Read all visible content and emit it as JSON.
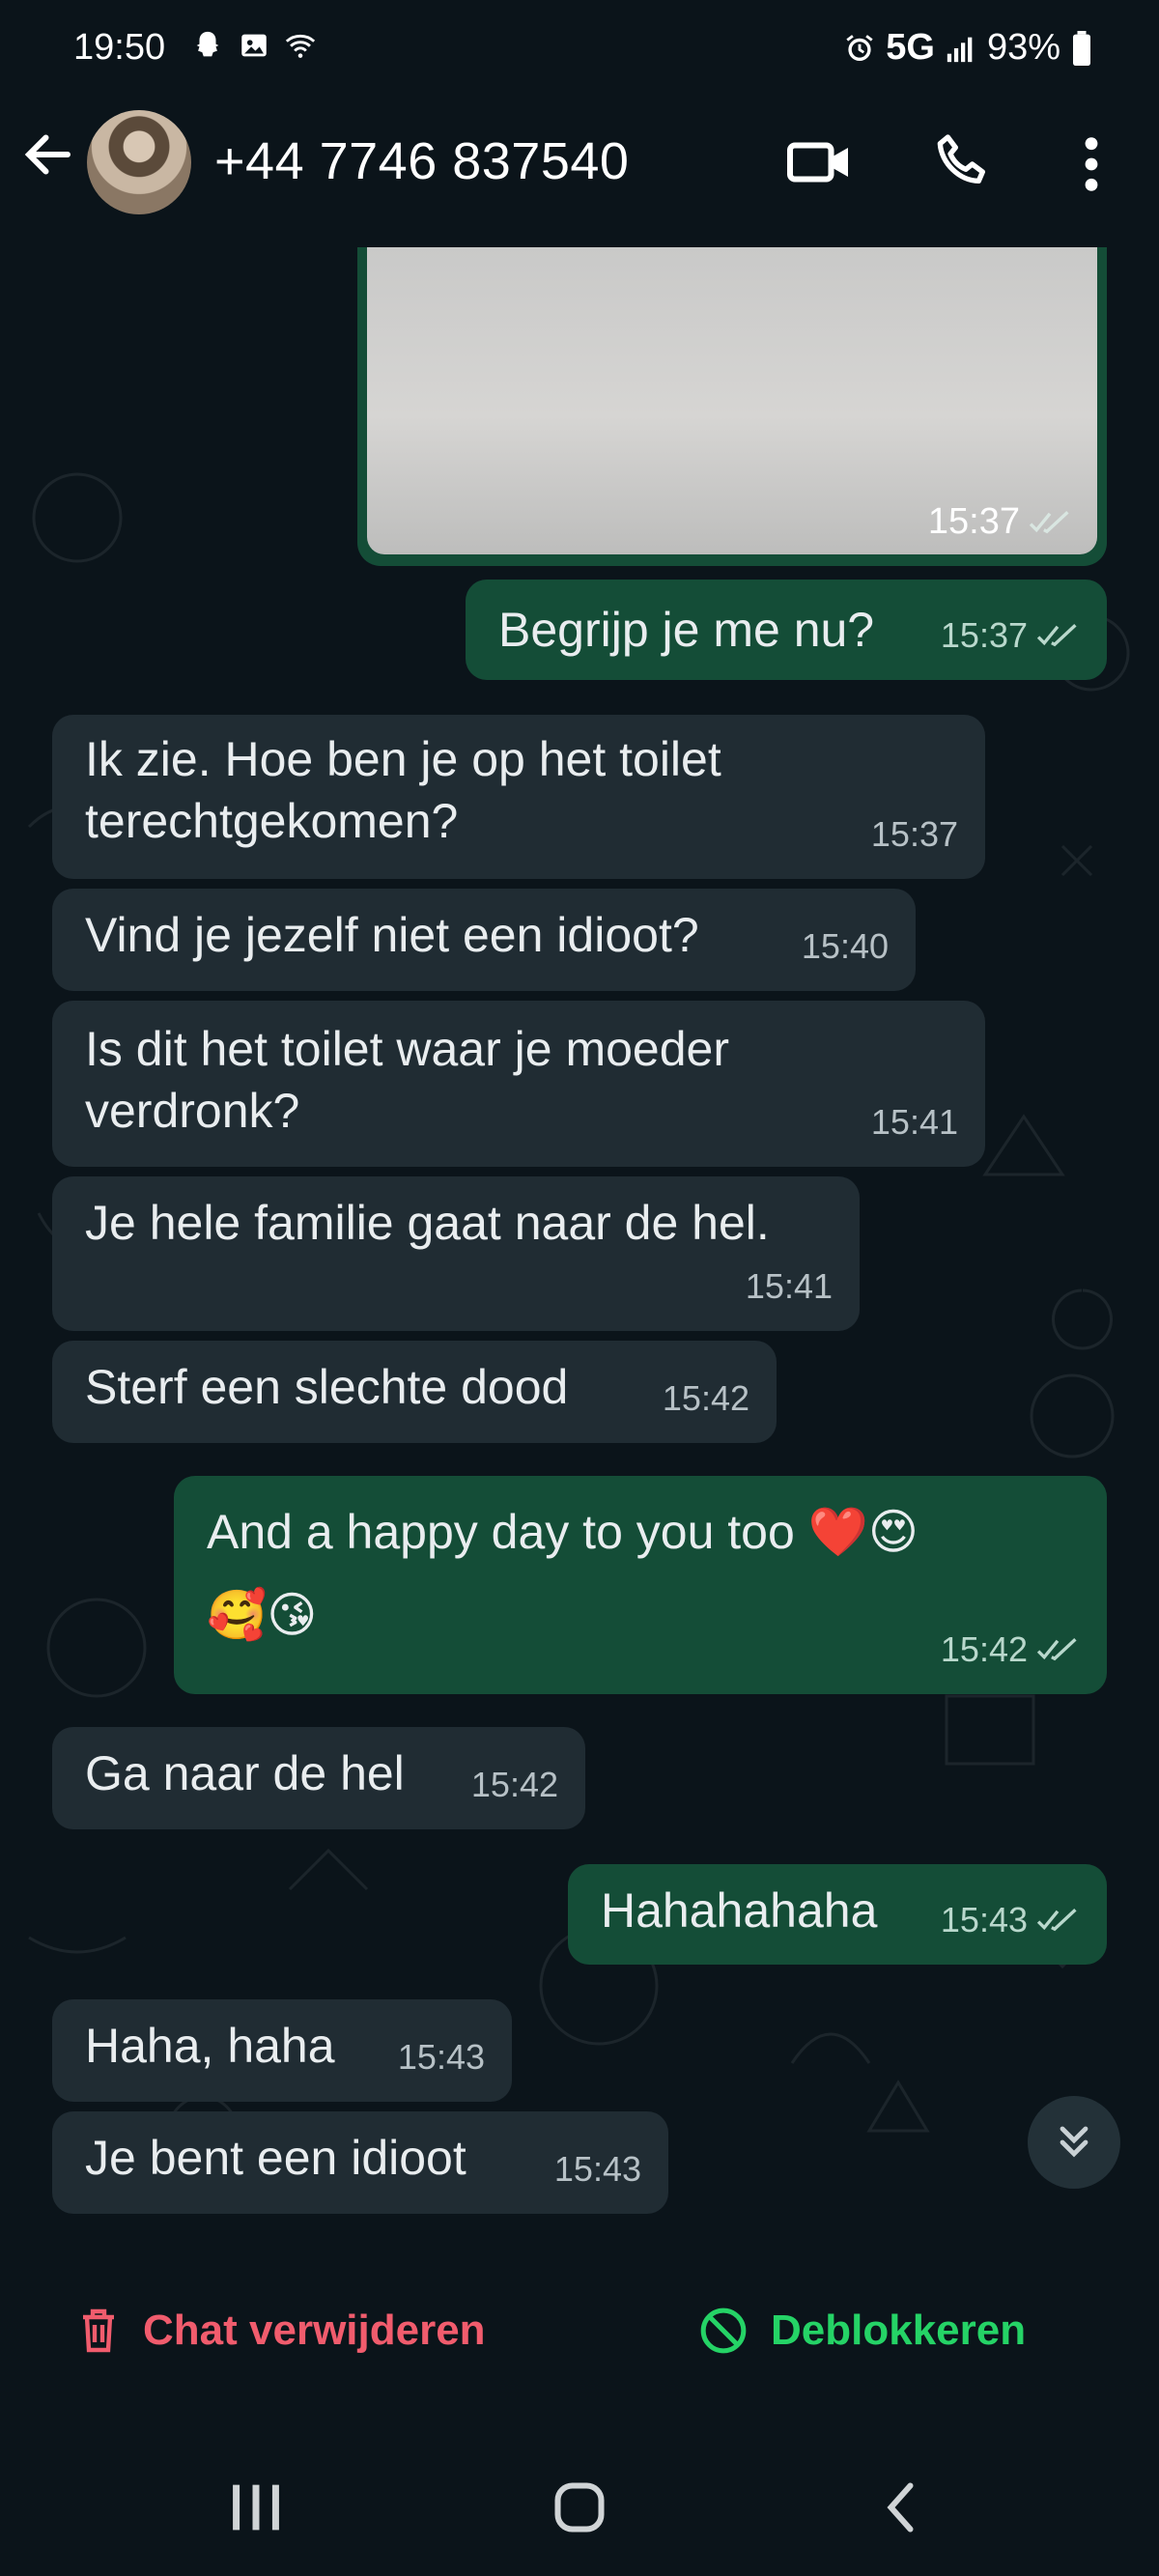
{
  "status_bar": {
    "time": "19:50",
    "network": "5G",
    "battery": "93%"
  },
  "header": {
    "contact_name": "+44 7746 837540"
  },
  "messages": [
    {
      "dir": "out",
      "type": "image",
      "time": "15:37"
    },
    {
      "dir": "out",
      "text": "Begrijp je me nu?",
      "time": "15:37"
    },
    {
      "dir": "in",
      "lines": [
        "Ik zie. Hoe ben je op het toilet",
        "terechtgekomen?"
      ],
      "time": "15:37"
    },
    {
      "dir": "in",
      "text": "Vind je jezelf niet een idioot?",
      "time": "15:40"
    },
    {
      "dir": "in",
      "lines": [
        "Is dit het toilet waar je moeder",
        "verdronk?"
      ],
      "time": "15:41"
    },
    {
      "dir": "in",
      "text": "Je hele familie gaat naar de hel.",
      "time": "15:41"
    },
    {
      "dir": "in",
      "text": "Sterf een slechte dood",
      "time": "15:42"
    },
    {
      "dir": "out",
      "lines": [
        "And a happy day to you too ❤️😍",
        "🥰😘"
      ],
      "time": "15:42"
    },
    {
      "dir": "in",
      "text": "Ga naar de hel",
      "time": "15:42"
    },
    {
      "dir": "out",
      "text": "Hahahahaha",
      "time": "15:43"
    },
    {
      "dir": "in",
      "text": "Haha, haha",
      "time": "15:43"
    },
    {
      "dir": "in",
      "text": "Je bent een idioot",
      "time": "15:43"
    }
  ],
  "actions": {
    "delete_label": "Chat verwijderen",
    "unblock_label": "Deblokkeren"
  },
  "colors": {
    "incoming": "#202c33",
    "outgoing": "#144d37",
    "delete": "#f15c6d",
    "unblock": "#25d366",
    "background": "#0b141a"
  }
}
